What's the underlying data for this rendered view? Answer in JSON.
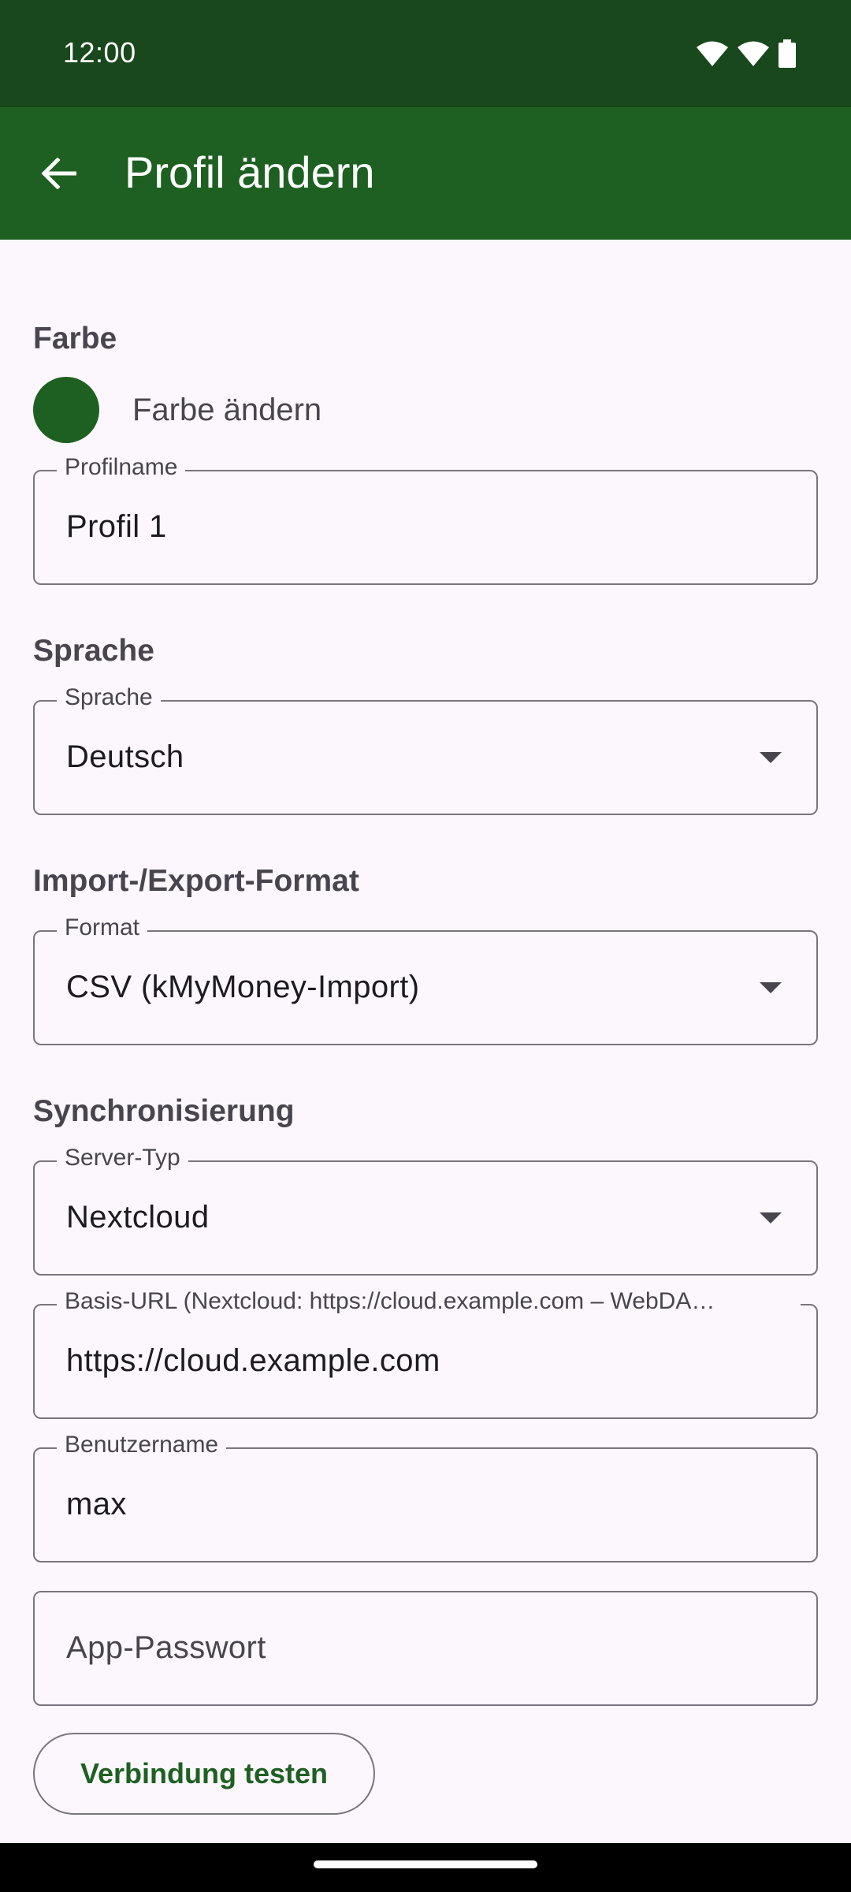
{
  "status_bar": {
    "time": "12:00",
    "icons": [
      "wifi-icon",
      "wifi-icon",
      "battery-icon"
    ]
  },
  "app_bar": {
    "back_icon": "arrow-back-icon",
    "title": "Profil ändern"
  },
  "colors": {
    "app_bar": "#1e6022",
    "status_bar": "#18481c",
    "background": "#fcf7fc",
    "accent": "#1e6022",
    "outline": "#79747e"
  },
  "color_section": {
    "heading": "Farbe",
    "change_label": "Farbe ändern",
    "selected_color": "#1e6022"
  },
  "profile_name": {
    "label": "Profilname",
    "value": "Profil 1"
  },
  "language_section": {
    "heading": "Sprache",
    "label": "Sprache",
    "value": "Deutsch"
  },
  "format_section": {
    "heading": "Import-/Export-Format",
    "label": "Format",
    "value": "CSV (kMyMoney-Import)"
  },
  "sync_section": {
    "heading": "Synchronisierung",
    "server_type": {
      "label": "Server-Typ",
      "value": "Nextcloud"
    },
    "base_url": {
      "label": "Basis-URL (Nextcloud: https://cloud.example.com – WebDA…",
      "value": "https://cloud.example.com"
    },
    "username": {
      "label": "Benutzername",
      "value": "max"
    },
    "app_password": {
      "placeholder": "App-Passwort"
    },
    "test_button": "Verbindung testen"
  }
}
